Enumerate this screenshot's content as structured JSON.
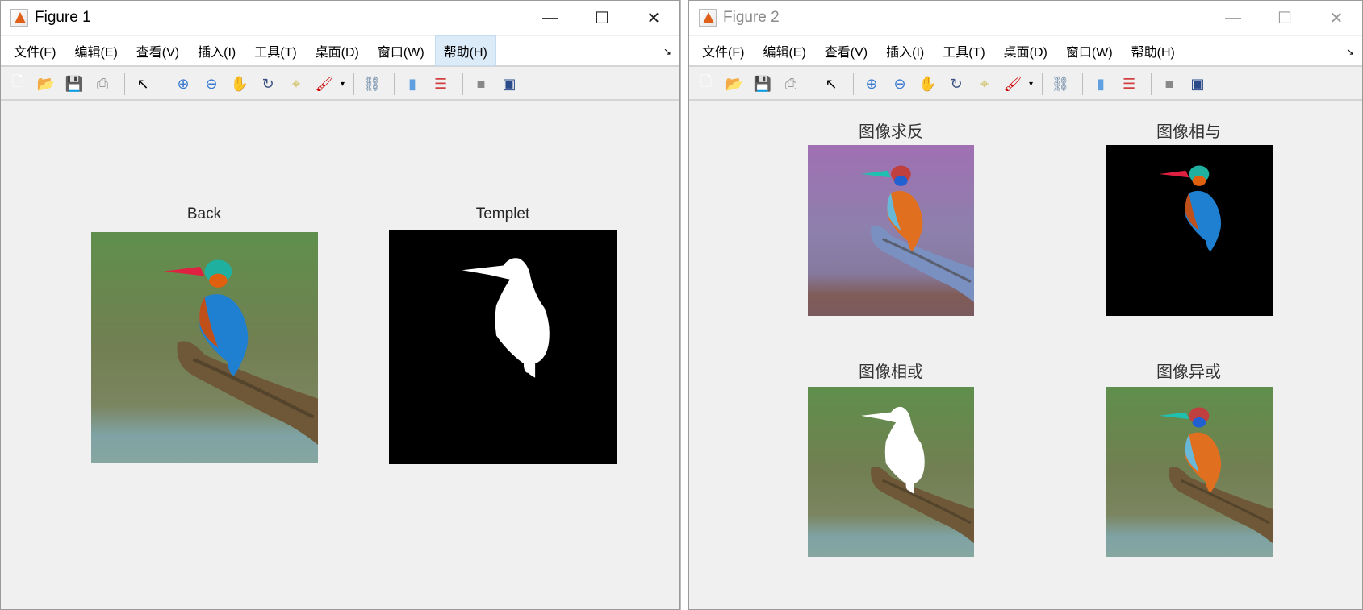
{
  "colors": {
    "highlight": "#dcebf8",
    "panel": "#f0f0f0"
  },
  "menu": [
    "文件(F)",
    "编辑(E)",
    "查看(V)",
    "插入(I)",
    "工具(T)",
    "桌面(D)",
    "窗口(W)",
    "帮助(H)"
  ],
  "window_controls": {
    "minimize": "—",
    "maximize": "☐",
    "close": "✕"
  },
  "toolbar_icons": [
    "new-figure-icon",
    "open-file-icon",
    "save-icon",
    "print-icon",
    "pointer-icon",
    "zoom-in-icon",
    "zoom-out-icon",
    "pan-icon",
    "rotate-3d-icon",
    "data-cursor-icon",
    "brush-icon",
    "link-plot-icon",
    "colorbar-icon",
    "legend-icon",
    "hide-plot-tools-icon",
    "show-plot-tools-icon"
  ],
  "figure1": {
    "title": "Figure 1",
    "axes": [
      {
        "title": "Back"
      },
      {
        "title": "Templet"
      }
    ]
  },
  "figure2": {
    "title": "Figure 2",
    "axes": [
      {
        "title": "图像求反"
      },
      {
        "title": "图像相与"
      },
      {
        "title": "图像相或"
      },
      {
        "title": "图像异或"
      }
    ]
  }
}
